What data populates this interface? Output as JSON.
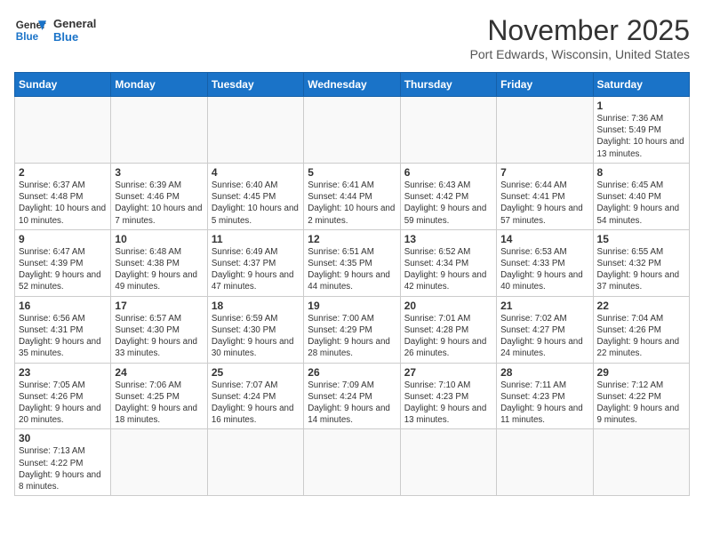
{
  "header": {
    "logo_line1": "General",
    "logo_line2": "Blue",
    "month": "November 2025",
    "location": "Port Edwards, Wisconsin, United States"
  },
  "days_of_week": [
    "Sunday",
    "Monday",
    "Tuesday",
    "Wednesday",
    "Thursday",
    "Friday",
    "Saturday"
  ],
  "weeks": [
    [
      {
        "day": "",
        "info": ""
      },
      {
        "day": "",
        "info": ""
      },
      {
        "day": "",
        "info": ""
      },
      {
        "day": "",
        "info": ""
      },
      {
        "day": "",
        "info": ""
      },
      {
        "day": "",
        "info": ""
      },
      {
        "day": "1",
        "info": "Sunrise: 7:36 AM\nSunset: 5:49 PM\nDaylight: 10 hours and 13 minutes."
      }
    ],
    [
      {
        "day": "2",
        "info": "Sunrise: 6:37 AM\nSunset: 4:48 PM\nDaylight: 10 hours and 10 minutes."
      },
      {
        "day": "3",
        "info": "Sunrise: 6:39 AM\nSunset: 4:46 PM\nDaylight: 10 hours and 7 minutes."
      },
      {
        "day": "4",
        "info": "Sunrise: 6:40 AM\nSunset: 4:45 PM\nDaylight: 10 hours and 5 minutes."
      },
      {
        "day": "5",
        "info": "Sunrise: 6:41 AM\nSunset: 4:44 PM\nDaylight: 10 hours and 2 minutes."
      },
      {
        "day": "6",
        "info": "Sunrise: 6:43 AM\nSunset: 4:42 PM\nDaylight: 9 hours and 59 minutes."
      },
      {
        "day": "7",
        "info": "Sunrise: 6:44 AM\nSunset: 4:41 PM\nDaylight: 9 hours and 57 minutes."
      },
      {
        "day": "8",
        "info": "Sunrise: 6:45 AM\nSunset: 4:40 PM\nDaylight: 9 hours and 54 minutes."
      }
    ],
    [
      {
        "day": "9",
        "info": "Sunrise: 6:47 AM\nSunset: 4:39 PM\nDaylight: 9 hours and 52 minutes."
      },
      {
        "day": "10",
        "info": "Sunrise: 6:48 AM\nSunset: 4:38 PM\nDaylight: 9 hours and 49 minutes."
      },
      {
        "day": "11",
        "info": "Sunrise: 6:49 AM\nSunset: 4:37 PM\nDaylight: 9 hours and 47 minutes."
      },
      {
        "day": "12",
        "info": "Sunrise: 6:51 AM\nSunset: 4:35 PM\nDaylight: 9 hours and 44 minutes."
      },
      {
        "day": "13",
        "info": "Sunrise: 6:52 AM\nSunset: 4:34 PM\nDaylight: 9 hours and 42 minutes."
      },
      {
        "day": "14",
        "info": "Sunrise: 6:53 AM\nSunset: 4:33 PM\nDaylight: 9 hours and 40 minutes."
      },
      {
        "day": "15",
        "info": "Sunrise: 6:55 AM\nSunset: 4:32 PM\nDaylight: 9 hours and 37 minutes."
      }
    ],
    [
      {
        "day": "16",
        "info": "Sunrise: 6:56 AM\nSunset: 4:31 PM\nDaylight: 9 hours and 35 minutes."
      },
      {
        "day": "17",
        "info": "Sunrise: 6:57 AM\nSunset: 4:30 PM\nDaylight: 9 hours and 33 minutes."
      },
      {
        "day": "18",
        "info": "Sunrise: 6:59 AM\nSunset: 4:30 PM\nDaylight: 9 hours and 30 minutes."
      },
      {
        "day": "19",
        "info": "Sunrise: 7:00 AM\nSunset: 4:29 PM\nDaylight: 9 hours and 28 minutes."
      },
      {
        "day": "20",
        "info": "Sunrise: 7:01 AM\nSunset: 4:28 PM\nDaylight: 9 hours and 26 minutes."
      },
      {
        "day": "21",
        "info": "Sunrise: 7:02 AM\nSunset: 4:27 PM\nDaylight: 9 hours and 24 minutes."
      },
      {
        "day": "22",
        "info": "Sunrise: 7:04 AM\nSunset: 4:26 PM\nDaylight: 9 hours and 22 minutes."
      }
    ],
    [
      {
        "day": "23",
        "info": "Sunrise: 7:05 AM\nSunset: 4:26 PM\nDaylight: 9 hours and 20 minutes."
      },
      {
        "day": "24",
        "info": "Sunrise: 7:06 AM\nSunset: 4:25 PM\nDaylight: 9 hours and 18 minutes."
      },
      {
        "day": "25",
        "info": "Sunrise: 7:07 AM\nSunset: 4:24 PM\nDaylight: 9 hours and 16 minutes."
      },
      {
        "day": "26",
        "info": "Sunrise: 7:09 AM\nSunset: 4:24 PM\nDaylight: 9 hours and 14 minutes."
      },
      {
        "day": "27",
        "info": "Sunrise: 7:10 AM\nSunset: 4:23 PM\nDaylight: 9 hours and 13 minutes."
      },
      {
        "day": "28",
        "info": "Sunrise: 7:11 AM\nSunset: 4:23 PM\nDaylight: 9 hours and 11 minutes."
      },
      {
        "day": "29",
        "info": "Sunrise: 7:12 AM\nSunset: 4:22 PM\nDaylight: 9 hours and 9 minutes."
      }
    ],
    [
      {
        "day": "30",
        "info": "Sunrise: 7:13 AM\nSunset: 4:22 PM\nDaylight: 9 hours and 8 minutes."
      },
      {
        "day": "",
        "info": ""
      },
      {
        "day": "",
        "info": ""
      },
      {
        "day": "",
        "info": ""
      },
      {
        "day": "",
        "info": ""
      },
      {
        "day": "",
        "info": ""
      },
      {
        "day": "",
        "info": ""
      }
    ]
  ]
}
